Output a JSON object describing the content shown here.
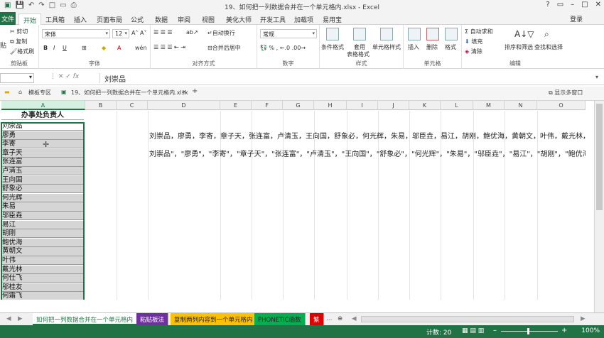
{
  "window": {
    "title": "19、如何把一列数据合并在一个单元格内.xlsx - Excel",
    "login": "登录"
  },
  "ribbon_tabs": [
    "文件",
    "开始",
    "工具箱",
    "插入",
    "页面布局",
    "公式",
    "数据",
    "审阅",
    "视图",
    "美化大师",
    "开发工具",
    "加载项",
    "易用宝"
  ],
  "clipboard": {
    "cut": "剪切",
    "copy": "复制",
    "painter": "格式刷",
    "paste": "贴",
    "label": "剪贴板"
  },
  "font": {
    "name": "宋体",
    "size": "12",
    "label": "字体"
  },
  "alignment": {
    "wrap": "自动换行",
    "merge": "合并后居中",
    "label": "对齐方式"
  },
  "number": {
    "format": "常规",
    "label": "数字"
  },
  "styles": {
    "cond": "条件格式",
    "table1": "套用",
    "table2": "表格格式",
    "cell": "单元格样式",
    "label": "样式"
  },
  "cells": {
    "insert": "插入",
    "delete": "删除",
    "format": "格式",
    "label": "单元格"
  },
  "editing": {
    "autosum": "自动求和",
    "fill": "填充",
    "clear": "清除",
    "sort": "排序和筛选",
    "find": "查找和选择",
    "label": "编辑"
  },
  "formula": {
    "namebox": "",
    "content": "刘崇品"
  },
  "doc_tabs": {
    "template": "模板专区",
    "file": "19、如何把一列数据合并在一个单元格内.xlsx",
    "multi": "显示多窗口"
  },
  "columns": [
    "A",
    "B",
    "C",
    "D",
    "E",
    "F",
    "G",
    "H",
    "I",
    "J",
    "K",
    "L",
    "M",
    "N",
    "O"
  ],
  "header_cell": "办事处负责人",
  "names": [
    "刘崇品",
    "廖勇",
    "李寄",
    "章子天",
    "张连富",
    "卢清玉",
    "王向国",
    "舒象必",
    "何光辉",
    "朱易",
    "邬臣垚",
    "易江",
    "胡刚",
    "鲍优海",
    "黄朝文",
    "叶伟",
    "戴光林",
    "何仕飞",
    "邬桂友",
    "何霜飞"
  ],
  "merged_text_1": "刘崇品，廖勇，李寄，章子天，张连富，卢清玉，王向国，舒象必，何光辉，朱易，邬臣垚，易江，胡刚，鲍优海，黄朝文，叶伟，戴光林，何仕飞，邬桂友，何",
  "merged_text_2": "刘崇品\"，\"廖勇\"，\"李寄\"，\"章子天\"，\"张连富\"，\"卢清玉\"，\"王向国\"，\"舒象必\"，\"何光辉\"，\"朱易\"，\"邬臣垚\"，\"易江\"，\"胡刚\"，\"鲍优海\"，\"黄朝文",
  "sheets": [
    {
      "label": "如何把一列数据合并在一个单元格内",
      "color": "#ffffff",
      "text": "#217346"
    },
    {
      "label": "粘贴板法",
      "color": "#7030a0",
      "text": "#ffffff"
    },
    {
      "label": "复制两列内容到一个单元格内",
      "color": "#ffc000",
      "text": "#222222"
    },
    {
      "label": "PHONETIC函数",
      "color": "#00b050",
      "text": "#222222"
    },
    {
      "label": "繁",
      "color": "#e00000",
      "text": "#ffffff"
    }
  ],
  "status": {
    "count": "计数: 20",
    "zoom": "100%"
  },
  "colors": {
    "accent": "#217346"
  }
}
